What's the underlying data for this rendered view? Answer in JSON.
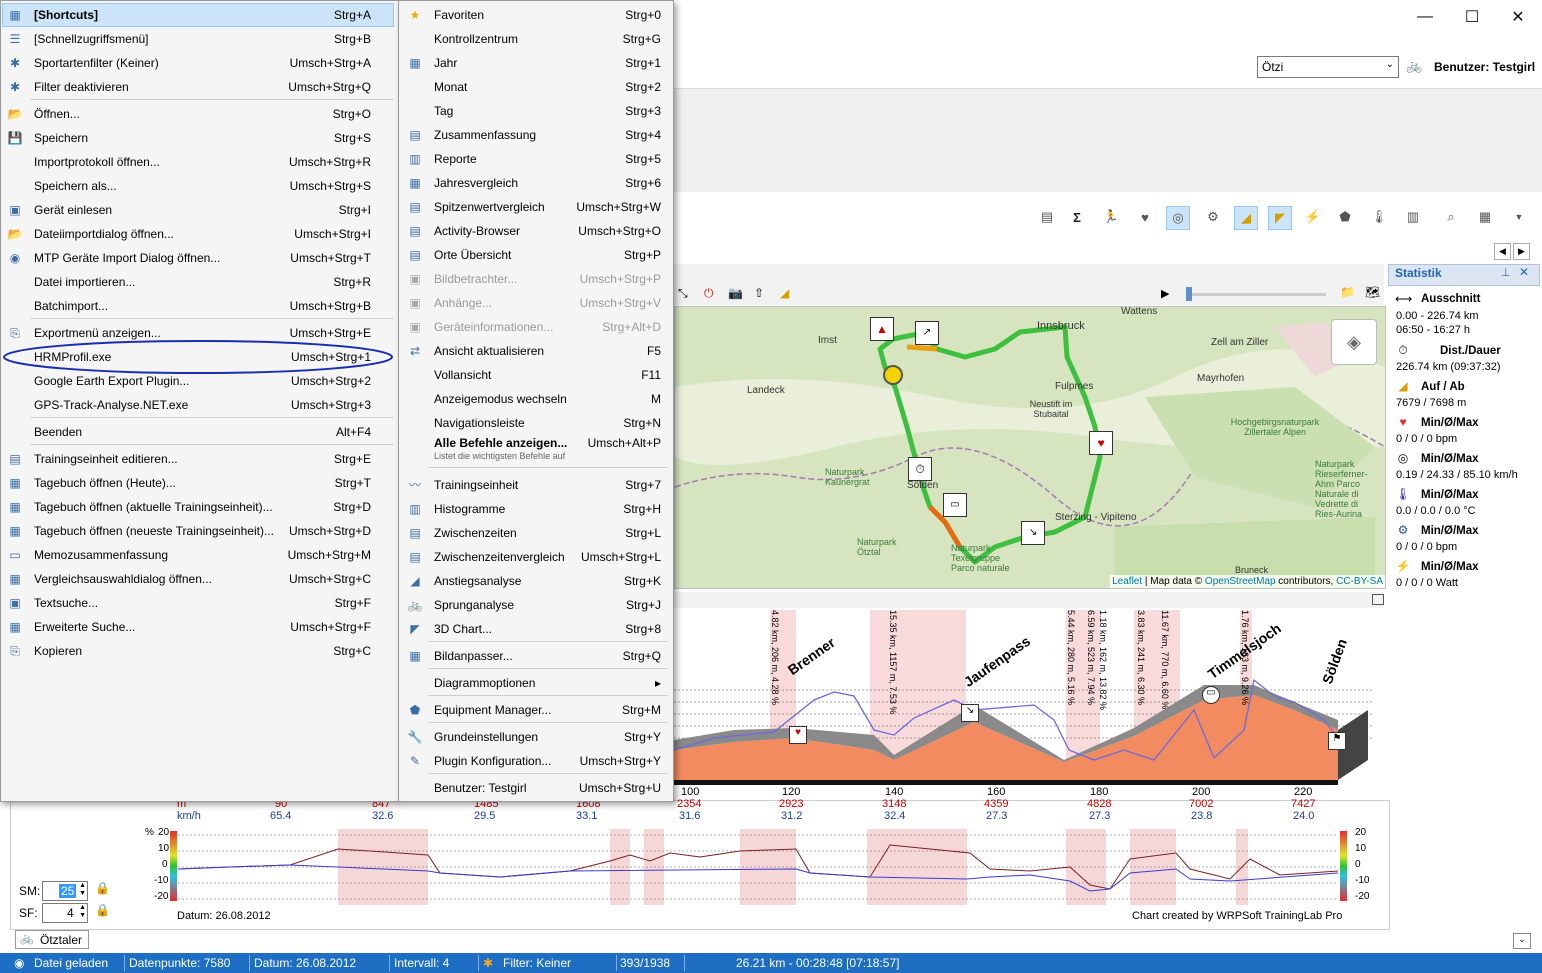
{
  "window": {
    "minimize_glyph": "—",
    "maximize_glyph": "☐",
    "close_glyph": "✕"
  },
  "header": {
    "athlete_select_value": "Ötzi",
    "user_label": "Benutzer: Testgirl"
  },
  "menu_left": {
    "items": [
      {
        "label": "[Shortcuts]",
        "shortcut": "Strg+A",
        "bold": true
      },
      {
        "label": "[Schnellzugriffsmenü]",
        "shortcut": "Strg+B"
      },
      {
        "label": "Sportartenfilter (Keiner)",
        "shortcut": "Umsch+Strg+A"
      },
      {
        "label": "Filter deaktivieren",
        "shortcut": "Umsch+Strg+Q"
      },
      {
        "label": "Öffnen...",
        "shortcut": "Strg+O"
      },
      {
        "label": "Speichern",
        "shortcut": "Strg+S"
      },
      {
        "label": "Importprotokoll öffnen...",
        "shortcut": "Umsch+Strg+R"
      },
      {
        "label": "Speichern als...",
        "shortcut": "Umsch+Strg+S"
      },
      {
        "label": "Gerät einlesen",
        "shortcut": "Strg+I"
      },
      {
        "label": "Dateiimportdialog öffnen...",
        "shortcut": "Umsch+Strg+I"
      },
      {
        "label": "MTP Geräte Import Dialog öffnen...",
        "shortcut": "Umsch+Strg+T"
      },
      {
        "label": "Datei importieren...",
        "shortcut": "Strg+R"
      },
      {
        "label": "Batchimport...",
        "shortcut": "Umsch+Strg+B"
      },
      {
        "label": "Exportmenü anzeigen...",
        "shortcut": "Umsch+Strg+E"
      },
      {
        "label": "HRMProfil.exe",
        "shortcut": "Umsch+Strg+1"
      },
      {
        "label": "Google Earth Export Plugin...",
        "shortcut": "Umsch+Strg+2"
      },
      {
        "label": "GPS-Track-Analyse.NET.exe",
        "shortcut": "Umsch+Strg+3"
      },
      {
        "label": "Beenden",
        "shortcut": "Alt+F4"
      },
      {
        "label": "Trainingseinheit editieren...",
        "shortcut": "Strg+E"
      },
      {
        "label": "Tagebuch öffnen (Heute)...",
        "shortcut": "Strg+T"
      },
      {
        "label": "Tagebuch öffnen (aktuelle Trainingseinheit)...",
        "shortcut": "Strg+D"
      },
      {
        "label": "Tagebuch öffnen (neueste Trainingseinheit)...",
        "shortcut": "Umsch+Strg+D"
      },
      {
        "label": "Memozusammenfassung",
        "shortcut": "Umsch+Strg+M"
      },
      {
        "label": "Vergleichsauswahldialog öffnen...",
        "shortcut": "Umsch+Strg+C"
      },
      {
        "label": "Textsuche...",
        "shortcut": "Strg+F"
      },
      {
        "label": "Erweiterte Suche...",
        "shortcut": "Umsch+Strg+F"
      },
      {
        "label": "Kopieren",
        "shortcut": "Strg+C"
      }
    ]
  },
  "menu_right": {
    "items": [
      {
        "label": "Favoriten",
        "shortcut": "Strg+0"
      },
      {
        "label": "Kontrollzentrum",
        "shortcut": "Strg+G"
      },
      {
        "label": "Jahr",
        "shortcut": "Strg+1"
      },
      {
        "label": "Monat",
        "shortcut": "Strg+2"
      },
      {
        "label": "Tag",
        "shortcut": "Strg+3"
      },
      {
        "label": "Zusammenfassung",
        "shortcut": "Strg+4"
      },
      {
        "label": "Reporte",
        "shortcut": "Strg+5"
      },
      {
        "label": "Jahresvergleich",
        "shortcut": "Strg+6"
      },
      {
        "label": "Spitzenwertvergleich",
        "shortcut": "Umsch+Strg+W"
      },
      {
        "label": "Activity-Browser",
        "shortcut": "Umsch+Strg+O"
      },
      {
        "label": "Orte Übersicht",
        "shortcut": "Strg+P"
      },
      {
        "label": "Bildbetrachter...",
        "shortcut": "Umsch+Strg+P",
        "disabled": true
      },
      {
        "label": "Anhänge...",
        "shortcut": "Umsch+Strg+V",
        "disabled": true
      },
      {
        "label": "Geräteinformationen...",
        "shortcut": "Strg+Alt+D",
        "disabled": true
      },
      {
        "label": "Ansicht aktualisieren",
        "shortcut": "F5"
      },
      {
        "label": "Vollansicht",
        "shortcut": "F11"
      },
      {
        "label": "Anzeigemodus wechseln",
        "shortcut": "M"
      },
      {
        "label": "Navigationsleiste",
        "shortcut": "Strg+N"
      },
      {
        "label": "Alle Befehle anzeigen...",
        "shortcut": "Umsch+Alt+P",
        "bold": true,
        "sub": "Listet die wichtigsten Befehle auf"
      },
      {
        "label": "Trainingseinheit",
        "shortcut": "Strg+7"
      },
      {
        "label": "Histogramme",
        "shortcut": "Strg+H"
      },
      {
        "label": "Zwischenzeiten",
        "shortcut": "Strg+L"
      },
      {
        "label": "Zwischenzeitenvergleich",
        "shortcut": "Umsch+Strg+L"
      },
      {
        "label": "Anstiegsanalyse",
        "shortcut": "Strg+K"
      },
      {
        "label": "Sprunganalyse",
        "shortcut": "Strg+J"
      },
      {
        "label": "3D Chart...",
        "shortcut": "Strg+8"
      },
      {
        "label": "Bildanpasser...",
        "shortcut": "Strg+Q"
      },
      {
        "label": "Diagrammoptionen",
        "shortcut": "▸"
      },
      {
        "label": "Equipment Manager...",
        "shortcut": "Strg+M"
      },
      {
        "label": "Grundeinstellungen",
        "shortcut": "Strg+Y"
      },
      {
        "label": "Plugin Konfiguration...",
        "shortcut": "Umsch+Strg+Y"
      },
      {
        "label": "Benutzer: Testgirl",
        "shortcut": "Umsch+Strg+U"
      }
    ]
  },
  "statistics": {
    "title": "Statistik",
    "ausschnitt_label": "Ausschnitt",
    "ausschnitt_km": "0.00 - 226.74 km",
    "ausschnitt_time": "06:50 - 16:27 h",
    "dist_label": "Dist./Dauer",
    "dist_value": "226.74 km (09:37:32)",
    "auf_label": "Auf / Ab",
    "auf_value": "7679 / 7698 m",
    "hr_label": "Min/Ø/Max",
    "hr_value": "0 / 0 / 0 bpm",
    "speed_label": "Min/Ø/Max",
    "speed_value": "0.19 / 24.33 / 85.10 km/h",
    "temp_label": "Min/Ø/Max",
    "temp_value": "0.0 / 0.0 / 0.0 °C",
    "cad_label": "Min/Ø/Max",
    "cad_value": "0 / 0 / 0 bpm",
    "power_label": "Min/Ø/Max",
    "power_value": "0 / 0 / 0 Watt"
  },
  "map": {
    "places": [
      "Imst",
      "Innsbruck",
      "Wattens",
      "Zell am Ziller",
      "Landeck",
      "Fulpmes",
      "Neustift im Stubaital",
      "Mayrhofen",
      "Hochgebirgsnaturpark Zillertaler Alpen",
      "Naturpark Kaunergrat",
      "Sölden",
      "Sterzing - Vipiteno",
      "Naturpark Rieserferner-Ahrn Parco Naturale di Vedrette di Ries-Aurina",
      "Naturpark Ötztal",
      "Naturpark Texelgruppe Parco naturale",
      "Bruneck"
    ],
    "attribution_leaflet": "Leaflet",
    "attribution_sep": " | Map data © ",
    "attribution_osm": "OpenStreetMap",
    "attribution_contrib": " contributors, ",
    "attribution_license": "CC-BY-SA"
  },
  "profile": {
    "pass_labels": [
      "Brenner",
      "Jaufenpass",
      "Timmelsjoch",
      "Sölden"
    ],
    "climb_labels": [
      "4.82 km, 206 m, 4.28 %",
      "15.35 km, 1157 m, 7.53 %",
      "5.44 km, 280 m, 5.16 %",
      "6.59 km, 523 m, 7.94 %",
      "1.18 km, 162 m, 13.82 %",
      "3.83 km, 241 m, 6.30 %",
      "11.67 km, 770 m, 6.60 %",
      "1.76 km, 163 m, 9.26 %"
    ],
    "km_ticks": [
      "100",
      "120",
      "140",
      "160",
      "180",
      "200",
      "220"
    ],
    "alt_ticks": [
      "2354",
      "2923",
      "3148",
      "4359",
      "4828",
      "7002",
      "7427"
    ],
    "speed_ticks": [
      "31.6",
      "31.2",
      "32.4",
      "27.3",
      "27.3",
      "23.8",
      "24.0"
    ],
    "left_alt": [
      "90",
      "847",
      "1485",
      "1608"
    ],
    "left_speed": [
      "65.4",
      "32.6",
      "29.5",
      "33.1"
    ],
    "unit_m": "m",
    "unit_kmh": "km/h",
    "grade_unit": "%",
    "grade_axis": [
      "20",
      "10",
      "0",
      "-10",
      "-20"
    ],
    "date_label": "Datum: 26.08.2012",
    "credit": "Chart created by WRPSoft TrainingLab Pro"
  },
  "controls": {
    "sm_label": "SM:",
    "sm_value": "25",
    "sf_label": "SF:",
    "sf_value": "4",
    "tab_label": "Ötztaler"
  },
  "statusbar": {
    "loaded": "Datei geladen",
    "points": "Datenpunkte: 7580",
    "date": "Datum: 26.08.2012",
    "interval": "Intervall: 4",
    "filter": "Filter: Keiner",
    "index": "393/1938",
    "position": "26.21 km - 00:28:48 [07:18:57]"
  },
  "colors": {
    "accent": "#1e6fc3",
    "highlight": "#cce4f7",
    "hrm_circle": "#1a2fb0",
    "altitude_fill": "#f28c60",
    "route": "#3fbf3f"
  }
}
